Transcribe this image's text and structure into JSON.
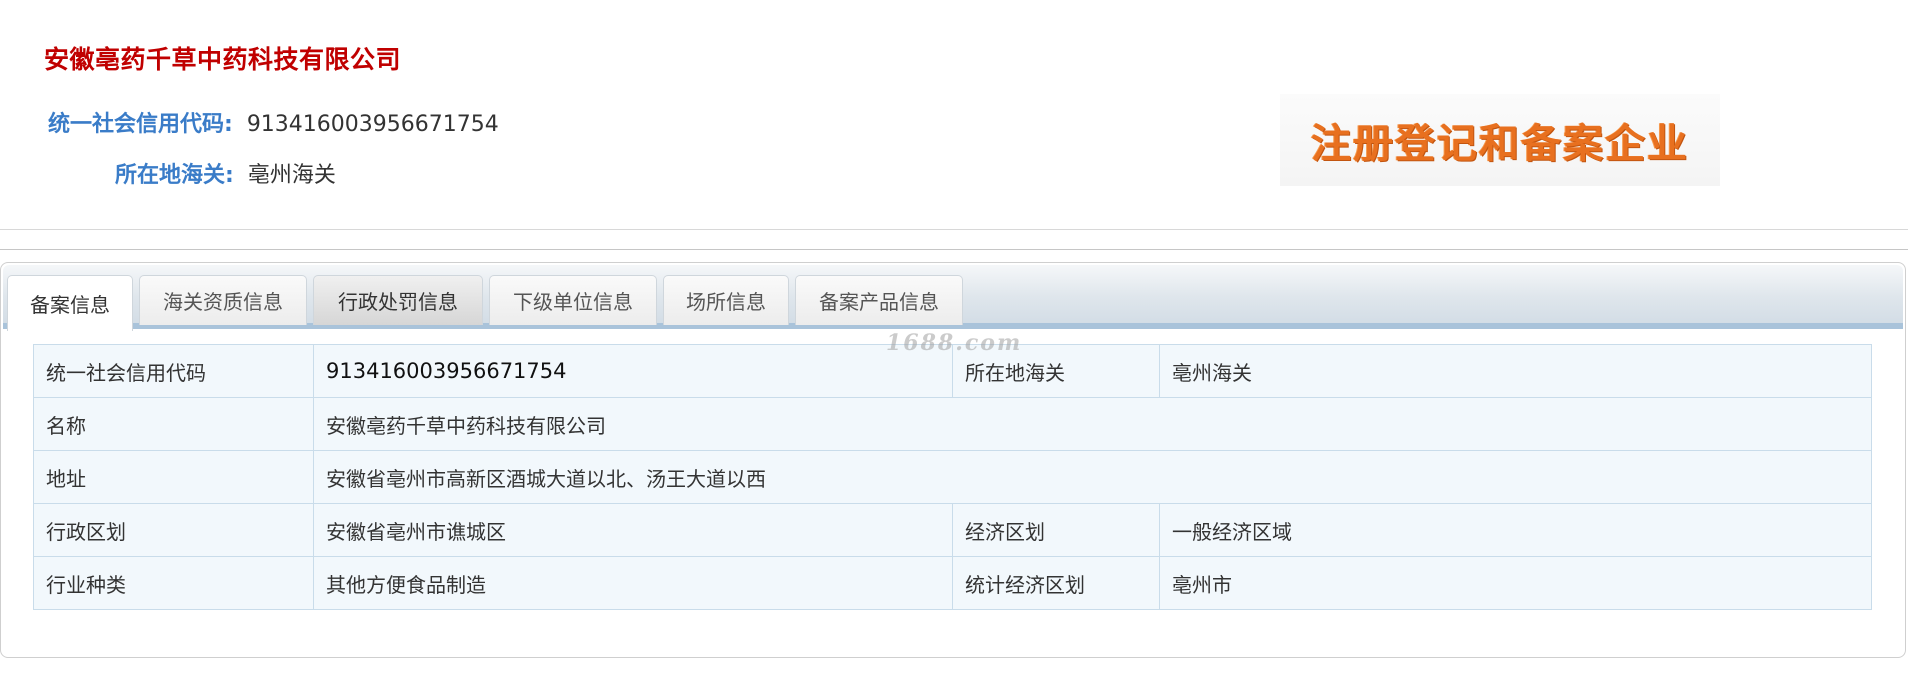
{
  "header": {
    "company_name": "安徽亳药千草中药科技有限公司",
    "credit_code_label": "统一社会信用代码:",
    "credit_code_value": "913416003956671754",
    "customs_label": "所在地海关:",
    "customs_value": "亳州海关",
    "banner_text": "注册登记和备案企业"
  },
  "tabs": [
    {
      "label": "备案信息",
      "active": true
    },
    {
      "label": "海关资质信息",
      "active": false
    },
    {
      "label": "行政处罚信息",
      "active": false
    },
    {
      "label": "下级单位信息",
      "active": false
    },
    {
      "label": "场所信息",
      "active": false
    },
    {
      "label": "备案产品信息",
      "active": false
    }
  ],
  "watermark": "1688.com",
  "record_table": {
    "credit_code_label": "统一社会信用代码",
    "credit_code_value": "913416003956671754",
    "customs_label": "所在地海关",
    "customs_value": "亳州海关",
    "name_label": "名称",
    "name_value": "安徽亳药千草中药科技有限公司",
    "address_label": "地址",
    "address_value": "安徽省亳州市高新区酒城大道以北、汤王大道以西",
    "admin_region_label": "行政区划",
    "admin_region_value": "安徽省亳州市谯城区",
    "econ_region_label": "经济区划",
    "econ_region_value": "一般经济区域",
    "industry_label": "行业种类",
    "industry_value": "其他方便食品制造",
    "stat_region_label": "统计经济区划",
    "stat_region_value": "亳州市"
  },
  "colors": {
    "title_red": "#c00000",
    "label_blue": "#3a7cc8",
    "banner_orange": "#e8701f",
    "table_bg": "#f2f8fc",
    "table_border": "#c9dcea"
  }
}
